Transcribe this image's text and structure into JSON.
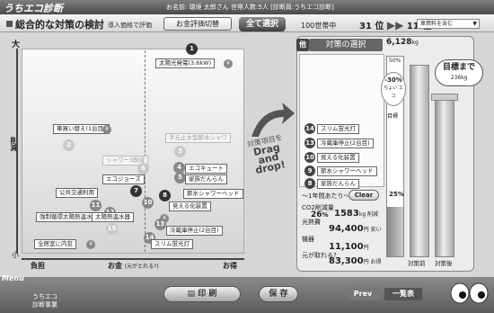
{
  "header": {
    "logo": "うちエコ診断",
    "user_info": "お名前: 環境 太郎さん 世帯人数:5人 [診断員:うちエコ診断]",
    "category_select": "車燃料を含む"
  },
  "toolbar": {
    "page_title": "総合的な対策の検討",
    "evaluate_label": "導入価格で評価",
    "eval_toggle": "お金評価切替",
    "select_all": "全て選択",
    "century_label": "100世帯中",
    "rank_before": "31 位",
    "rank_after": "11 位",
    "arrow": "▶▶"
  },
  "chart": {
    "y_top": "大",
    "y_mid": "削減",
    "y_bottom": "小",
    "x_left": "負担",
    "x_mid": "お金",
    "x_mid_note": "(元がとれる?)",
    "x_right": "お得",
    "yen": "¥",
    "items": [
      {
        "num": "1",
        "label": "太陽光発電(3.6kW)"
      },
      {
        "num": "2",
        "label": "車買い替え(1台目)"
      },
      {
        "num": "3",
        "label": "手元止水型節水シャワ"
      },
      {
        "num": "4",
        "label": "エコキュート"
      },
      {
        "num": "5",
        "label": "家族だんらん"
      },
      {
        "num": "6",
        "label": "シャワー3削減"
      },
      {
        "num": "7",
        "label": "エコジョーズ"
      },
      {
        "num": "8",
        "label": "節水シャワーヘッド"
      },
      {
        "num": "9",
        "label": "公共交通利用"
      },
      {
        "num": "10",
        "label": "見える化装置"
      },
      {
        "num": "11",
        "label": "強制循環太陽熱温水器"
      },
      {
        "num": "12",
        "label": "太陽熱温水器"
      },
      {
        "num": "13",
        "label": "冷蔵庫停止(2台目)"
      },
      {
        "num": "14",
        "label": "スリム蛍光灯"
      },
      {
        "num": "15",
        "label": "全居室に内窓"
      }
    ]
  },
  "drag_hint": {
    "line1": "対策項目を",
    "line2": "Drag",
    "line3": "and",
    "line4": "drop!"
  },
  "selection": {
    "tab": "他",
    "title": "対策の選択",
    "total": "6,128",
    "total_unit": "kg",
    "items": [
      {
        "num": "14",
        "label": "スリム蛍光灯"
      },
      {
        "num": "13",
        "label": "冷蔵庫停止(2台目)"
      },
      {
        "num": "10",
        "label": "見える化装置"
      },
      {
        "num": "9",
        "label": "節水シャワーヘッド"
      },
      {
        "num": "8",
        "label": "家族だんらん"
      }
    ],
    "bubble_pct": "-30%",
    "bubble_note": "ちょい エコ",
    "target_label": "目標",
    "pct_top": "50%",
    "pct_bottom": "25%",
    "progress": 0.25,
    "per_year": "～1年間あたり～",
    "clear": "Clear",
    "co2_label": "CO2削減量",
    "co2_pct": "26",
    "co2_pct_unit": "%",
    "co2_value": "1583",
    "co2_unit": "kg 削減",
    "fuel_label": "光熱費",
    "fuel_value": "94,400",
    "fuel_unit": "円 安い",
    "equip_label": "機器",
    "equip_value": "11,100",
    "equip_unit": "円",
    "payback_label": "元が取れる?",
    "payback_value": "83,300",
    "payback_unit": "円 お得"
  },
  "goal": {
    "title": "目標まで",
    "value": "236kg",
    "before": "対策前",
    "after": "対策後"
  },
  "footer": {
    "menu": "Menu",
    "logo_line1": "うちエコ",
    "logo_line2": "診断事業",
    "print": "印 刷",
    "save": "保 存",
    "prev": "Prev",
    "list": "一覧表"
  }
}
